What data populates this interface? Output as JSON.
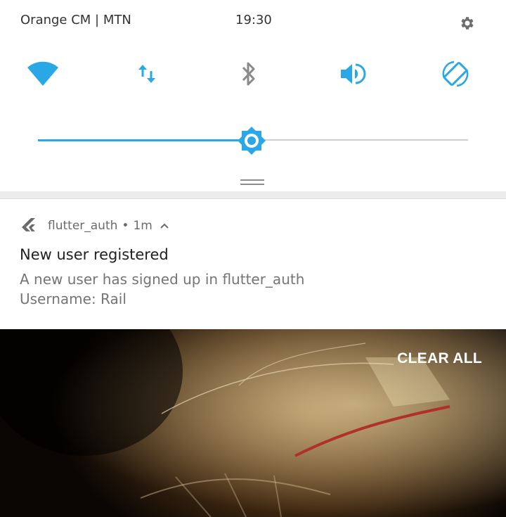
{
  "status_bar": {
    "carrier": "Orange CM | MTN",
    "time": "19:30",
    "settings_icon": "gear-icon"
  },
  "quick_settings": {
    "tiles": [
      {
        "icon": "wifi-icon",
        "state": "on",
        "color": "#2aa8e6"
      },
      {
        "icon": "data-transfer-icon",
        "state": "on",
        "color": "#2aa8e6"
      },
      {
        "icon": "bluetooth-icon",
        "state": "off",
        "color": "#8a8a8a"
      },
      {
        "icon": "volume-icon",
        "state": "on",
        "color": "#2aa8e6"
      },
      {
        "icon": "auto-rotate-icon",
        "state": "on",
        "color": "#2aa8e6"
      }
    ],
    "brightness": {
      "level": 0.5,
      "icon": "brightness-icon",
      "accent": "#2aa8e6"
    }
  },
  "notification": {
    "app_icon": "flutter-icon",
    "app_name": "flutter_auth",
    "separator": "•",
    "time_ago": "1m",
    "expand_icon": "chevron-up-icon",
    "title": "New user registered",
    "body_line1": "A new user has signed up in flutter_auth",
    "body_line2": "Username: Rail"
  },
  "actions": {
    "clear_all": "CLEAR ALL"
  }
}
